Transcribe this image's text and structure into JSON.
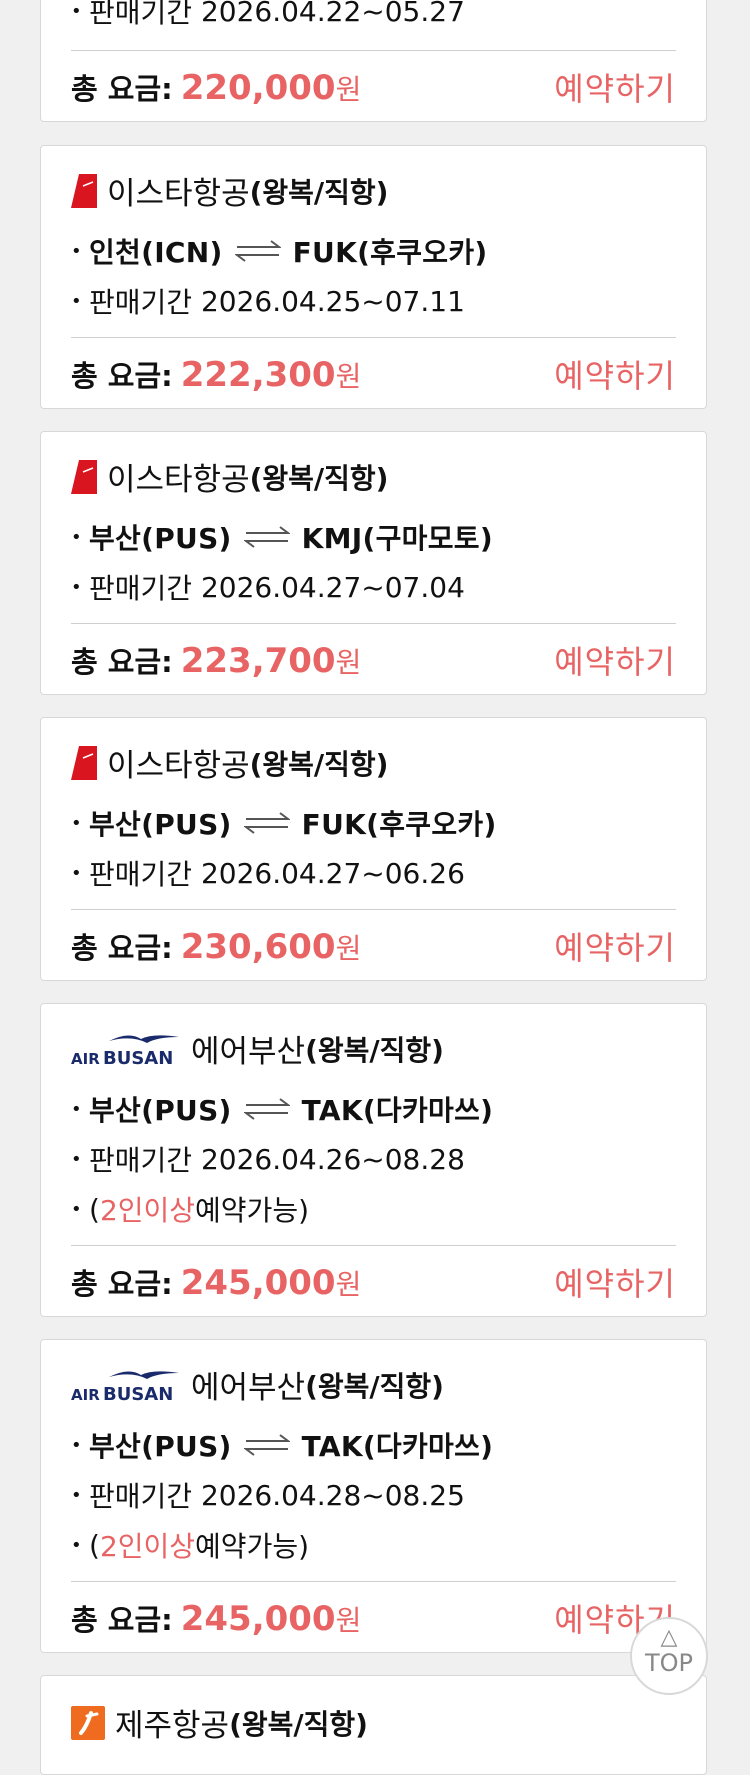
{
  "colors": {
    "accent": "#e86464",
    "eastar_red": "#d9161f",
    "busan_navy": "#1a2b6b",
    "jeju_orange": "#ee6b1f"
  },
  "partial_top": {
    "period_label": "판매기간",
    "period": "2026.04.22~05.27",
    "price_label": "총 요금:",
    "price": "220,000",
    "price_unit": "원",
    "book_label": "예약하기"
  },
  "cards": [
    {
      "logo": "eastar-logo",
      "airline": "이스타항공",
      "type": "(왕복/직항)",
      "from": "인천(ICN)",
      "to": "FUK(후쿠오카)",
      "period_label": "판매기간",
      "period": "2026.04.25~07.11",
      "note": null,
      "price_label": "총 요금:",
      "price": "222,300",
      "price_unit": "원",
      "book_label": "예약하기"
    },
    {
      "logo": "eastar-logo",
      "airline": "이스타항공",
      "type": "(왕복/직항)",
      "from": "부산(PUS)",
      "to": "KMJ(구마모토)",
      "period_label": "판매기간",
      "period": "2026.04.27~07.04",
      "note": null,
      "price_label": "총 요금:",
      "price": "223,700",
      "price_unit": "원",
      "book_label": "예약하기"
    },
    {
      "logo": "eastar-logo",
      "airline": "이스타항공",
      "type": "(왕복/직항)",
      "from": "부산(PUS)",
      "to": "FUK(후쿠오카)",
      "period_label": "판매기간",
      "period": "2026.04.27~06.26",
      "note": null,
      "price_label": "총 요금:",
      "price": "230,600",
      "price_unit": "원",
      "book_label": "예약하기"
    },
    {
      "logo": "airbusan-logo",
      "airline": "에어부산",
      "type": "(왕복/직항)",
      "from": "부산(PUS)",
      "to": "TAK(다카마쓰)",
      "period_label": "판매기간",
      "period": "2026.04.26~08.28",
      "note": {
        "open": "(",
        "highlight": "2인이상",
        "rest": " 예약가능)"
      },
      "price_label": "총 요금:",
      "price": "245,000",
      "price_unit": "원",
      "book_label": "예약하기"
    },
    {
      "logo": "airbusan-logo",
      "airline": "에어부산",
      "type": "(왕복/직항)",
      "from": "부산(PUS)",
      "to": "TAK(다카마쓰)",
      "period_label": "판매기간",
      "period": "2026.04.28~08.25",
      "note": {
        "open": "(",
        "highlight": "2인이상",
        "rest": " 예약가능)"
      },
      "price_label": "총 요금:",
      "price": "245,000",
      "price_unit": "원",
      "book_label": "예약하기"
    }
  ],
  "partial_bottom": {
    "logo": "jejuair-logo",
    "airline": "제주항공",
    "type": "(왕복/직항)"
  },
  "logo_text": {
    "busan_air": "AIR",
    "busan_name": "BUSAN"
  },
  "top_button": {
    "label": "TOP",
    "arrow": "△"
  }
}
